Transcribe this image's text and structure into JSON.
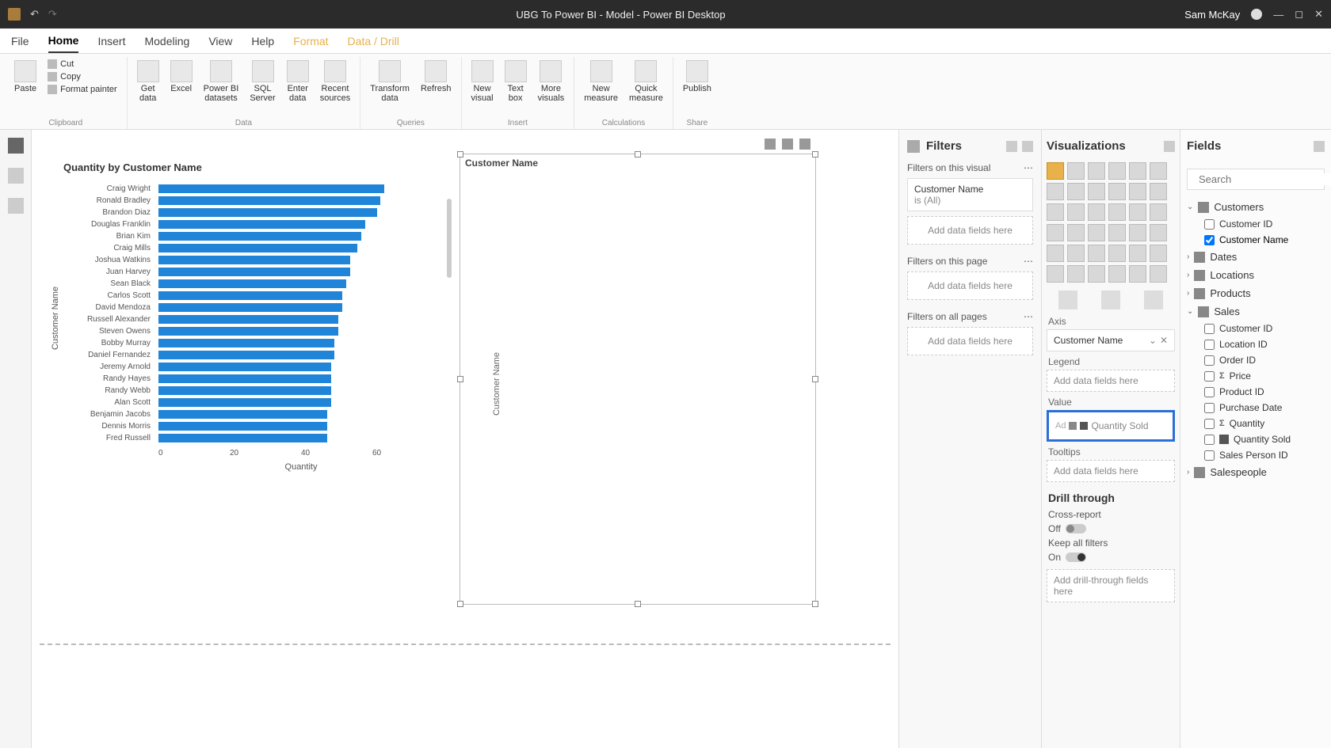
{
  "titlebar": {
    "title": "UBG To Power BI - Model - Power BI Desktop",
    "user": "Sam McKay"
  },
  "ribbon_tabs": [
    "File",
    "Home",
    "Insert",
    "Modeling",
    "View",
    "Help",
    "Format",
    "Data / Drill"
  ],
  "ribbon": {
    "clipboard": {
      "paste": "Paste",
      "cut": "Cut",
      "copy": "Copy",
      "format_painter": "Format painter",
      "label": "Clipboard"
    },
    "data": {
      "get_data": "Get\ndata",
      "excel": "Excel",
      "pbi_datasets": "Power BI\ndatasets",
      "sql": "SQL\nServer",
      "enter": "Enter\ndata",
      "recent": "Recent\nsources",
      "label": "Data"
    },
    "queries": {
      "transform": "Transform\ndata",
      "refresh": "Refresh",
      "label": "Queries"
    },
    "insert": {
      "new_visual": "New\nvisual",
      "text_box": "Text\nbox",
      "more_visuals": "More\nvisuals",
      "label": "Insert"
    },
    "calc": {
      "new_measure": "New\nmeasure",
      "quick_measure": "Quick\nmeasure",
      "label": "Calculations"
    },
    "share": {
      "publish": "Publish",
      "label": "Share"
    }
  },
  "chart": {
    "title": "Quantity by Customer Name",
    "y_axis_title": "Customer Name",
    "x_axis_title": "Quantity",
    "x_ticks": [
      "0",
      "20",
      "40",
      "60"
    ]
  },
  "chart_data": {
    "type": "bar",
    "orientation": "horizontal",
    "title": "Quantity by Customer Name",
    "xlabel": "Quantity",
    "ylabel": "Customer Name",
    "xlim": [
      0,
      60
    ],
    "categories": [
      "Craig Wright",
      "Ronald Bradley",
      "Brandon Diaz",
      "Douglas Franklin",
      "Brian Kim",
      "Craig Mills",
      "Joshua Watkins",
      "Juan Harvey",
      "Sean Black",
      "Carlos Scott",
      "David Mendoza",
      "Russell Alexander",
      "Steven Owens",
      "Bobby Murray",
      "Daniel Fernandez",
      "Jeremy Arnold",
      "Randy Hayes",
      "Randy Webb",
      "Alan Scott",
      "Benjamin Jacobs",
      "Dennis Morris",
      "Fred Russell"
    ],
    "values": [
      59,
      58,
      57,
      54,
      53,
      52,
      50,
      50,
      49,
      48,
      48,
      47,
      47,
      46,
      46,
      45,
      45,
      45,
      45,
      44,
      44,
      44
    ]
  },
  "second_visual": {
    "title": "Customer Name",
    "y_title": "Customer Name"
  },
  "filters": {
    "header": "Filters",
    "on_visual": "Filters on this visual",
    "card_field": "Customer Name",
    "card_value": "is (All)",
    "add_placeholder": "Add data fields here",
    "on_page": "Filters on this page",
    "on_all": "Filters on all pages"
  },
  "viz": {
    "header": "Visualizations",
    "axis_label": "Axis",
    "axis_value": "Customer Name",
    "legend_label": "Legend",
    "legend_placeholder": "Add data fields here",
    "value_label": "Value",
    "value_drag": "Quantity Sold",
    "tooltips_label": "Tooltips",
    "tooltips_placeholder": "Add data fields here",
    "drill_header": "Drill through",
    "cross_report": "Cross-report",
    "cross_state": "Off",
    "keep_filters": "Keep all filters",
    "keep_state": "On",
    "drill_placeholder": "Add drill-through fields here"
  },
  "fields": {
    "header": "Fields",
    "search_placeholder": "Search",
    "tables": [
      {
        "name": "Customers",
        "expanded": true,
        "fields": [
          {
            "name": "Customer ID",
            "checked": false
          },
          {
            "name": "Customer Name",
            "checked": true
          }
        ]
      },
      {
        "name": "Dates",
        "expanded": false
      },
      {
        "name": "Locations",
        "expanded": false
      },
      {
        "name": "Products",
        "expanded": false
      },
      {
        "name": "Sales",
        "expanded": true,
        "fields": [
          {
            "name": "Customer ID",
            "checked": false
          },
          {
            "name": "Location ID",
            "checked": false
          },
          {
            "name": "Order ID",
            "checked": false
          },
          {
            "name": "Price",
            "checked": false,
            "sigma": true
          },
          {
            "name": "Product ID",
            "checked": false
          },
          {
            "name": "Purchase Date",
            "checked": false
          },
          {
            "name": "Quantity",
            "checked": false,
            "sigma": true
          },
          {
            "name": "Quantity Sold",
            "checked": false,
            "icon": true
          },
          {
            "name": "Sales Person ID",
            "checked": false
          }
        ]
      },
      {
        "name": "Salespeople",
        "expanded": false
      }
    ]
  }
}
